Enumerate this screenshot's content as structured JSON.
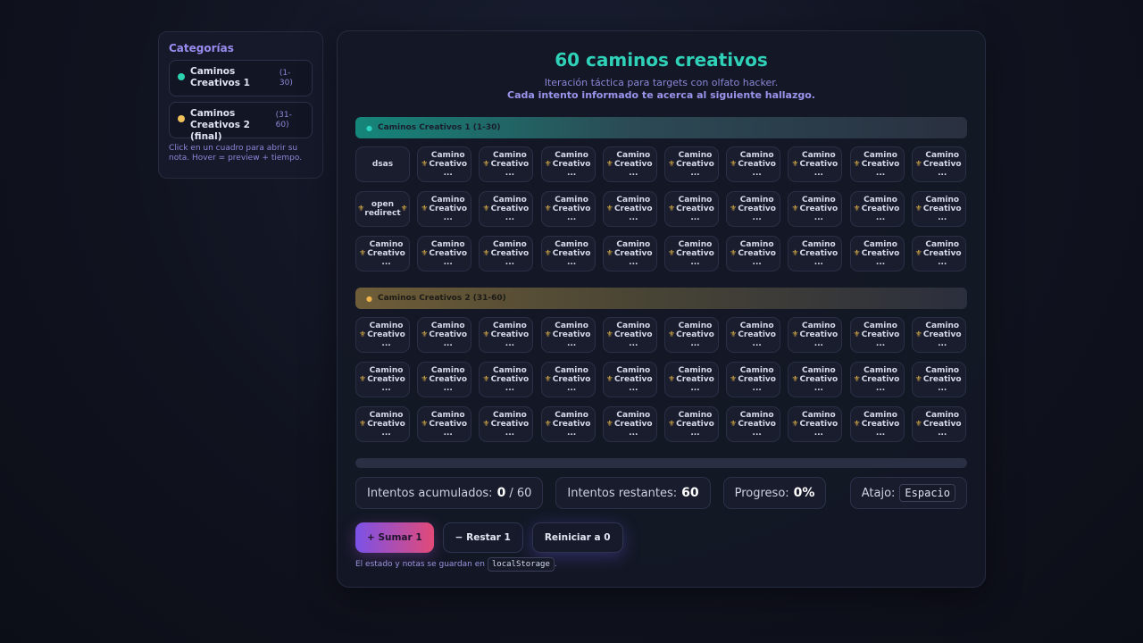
{
  "sidebar": {
    "title": "Categorías",
    "categories": [
      {
        "name": "Caminos Creativos 1",
        "range": "(1-30)",
        "color": "#2dd3b0"
      },
      {
        "name": "Caminos Creativos 2 (final)",
        "range": "(31-60)",
        "color": "#f0c05a"
      }
    ],
    "hint": "Click en un cuadro para abrir su nota. Hover = preview + tiempo."
  },
  "header": {
    "title": "60 caminos creativos",
    "subtitle": "Iteración táctica para targets con olfato hacker.",
    "subtitle_bold": "Cada intento informado te acerca al siguiente hallazgo."
  },
  "sections": [
    {
      "label": "Caminos Creativos 1 (1-30)",
      "bullet": "●",
      "cells": [
        "dsas",
        "⚜ Camino Creativo ...",
        "⚜ Camino Creativo ...",
        "⚜ Camino Creativo ...",
        "⚜ Camino Creativo ...",
        "⚜ Camino Creativo ...",
        "⚜ Camino Creativo ...",
        "⚜ Camino Creativo ...",
        "⚜ Camino Creativo ...",
        "⚜ Camino Creativo ...",
        "⚜ open redirect ⚜",
        "⚜ Camino Creativo ...",
        "⚜ Camino Creativo ...",
        "⚜ Camino Creativo ...",
        "⚜ Camino Creativo ...",
        "⚜ Camino Creativo ...",
        "⚜ Camino Creativo ...",
        "⚜ Camino Creativo ...",
        "⚜ Camino Creativo ...",
        "⚜ Camino Creativo ...",
        "⚜ Camino Creativo ...",
        "⚜ Camino Creativo ...",
        "⚜ Camino Creativo ...",
        "⚜ Camino Creativo ...",
        "⚜ Camino Creativo ...",
        "⚜ Camino Creativo ...",
        "⚜ Camino Creativo ...",
        "⚜ Camino Creativo ...",
        "⚜ Camino Creativo ...",
        "⚜ Camino Creativo ..."
      ]
    },
    {
      "label": "Caminos Creativos 2 (31-60)",
      "bullet": "●",
      "cells": [
        "⚜ Camino Creativo ...",
        "⚜ Camino Creativo ...",
        "⚜ Camino Creativo ...",
        "⚜ Camino Creativo ...",
        "⚜ Camino Creativo ...",
        "⚜ Camino Creativo ...",
        "⚜ Camino Creativo ...",
        "⚜ Camino Creativo ...",
        "⚜ Camino Creativo ...",
        "⚜ Camino Creativo ...",
        "⚜ Camino Creativo ...",
        "⚜ Camino Creativo ...",
        "⚜ Camino Creativo ...",
        "⚜ Camino Creativo ...",
        "⚜ Camino Creativo ...",
        "⚜ Camino Creativo ...",
        "⚜ Camino Creativo ...",
        "⚜ Camino Creativo ...",
        "⚜ Camino Creativo ...",
        "⚜ Camino Creativo ...",
        "⚜ Camino Creativo ...",
        "⚜ Camino Creativo ...",
        "⚜ Camino Creativo ...",
        "⚜ Camino Creativo ...",
        "⚜ Camino Creativo ...",
        "⚜ Camino Creativo ...",
        "⚜ Camino Creativo ...",
        "⚜ Camino Creativo ...",
        "⚜ Camino Creativo ...",
        "⚜ Camino Creativo ..."
      ]
    }
  ],
  "progress": {
    "fraction": 0
  },
  "stats": {
    "accumulated_label": "Intentos acumulados:",
    "accumulated_value": "0",
    "accumulated_total": "/ 60",
    "remaining_label": "Intentos restantes:",
    "remaining_value": "60",
    "progress_label": "Progreso:",
    "progress_value": "0%",
    "shortcut_label": "Atajo:",
    "shortcut_key": "Espacio"
  },
  "buttons": {
    "add": "+ Sumar 1",
    "subtract": "− Restar 1",
    "reset": "Reiniciar a 0"
  },
  "footnote": {
    "text": "El estado y notas se guardan en",
    "code": "localStorage",
    "end": "."
  }
}
